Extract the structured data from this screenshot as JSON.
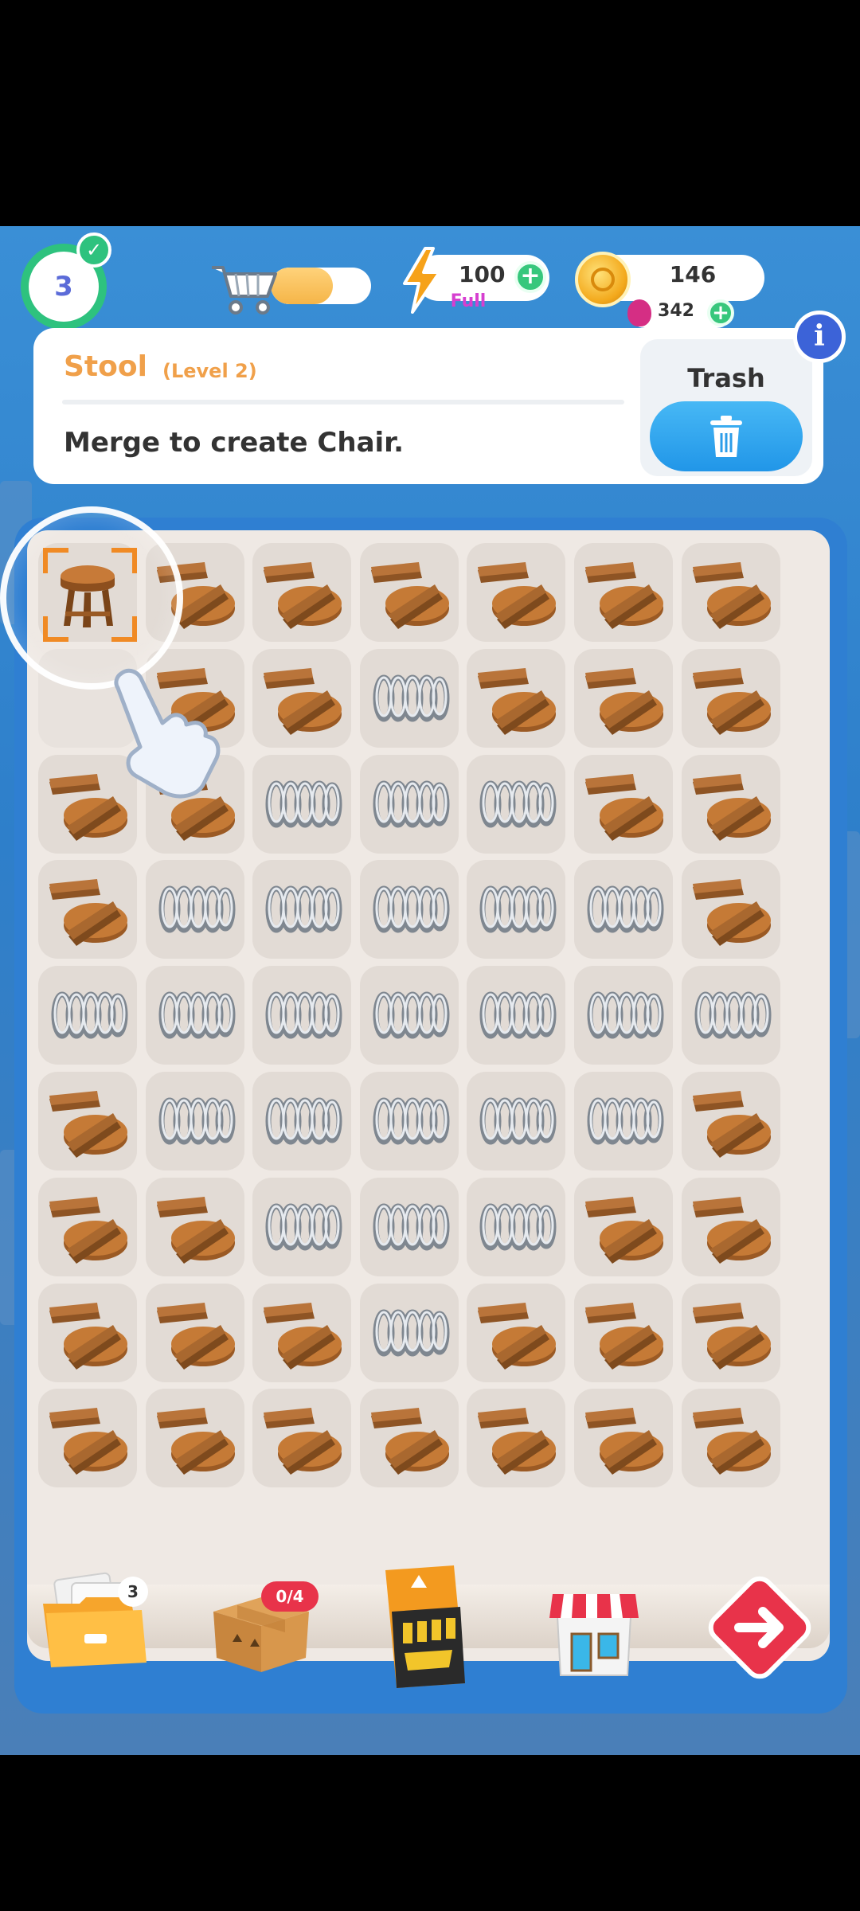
{
  "hud": {
    "level": "3",
    "cart_progress": 0.62,
    "energy": {
      "value": "100",
      "status": "Full"
    },
    "coins": "146",
    "gems": "342"
  },
  "info_panel": {
    "item_name": "Stool",
    "item_level": "(Level 2)",
    "description": "Merge to create Chair.",
    "trash_label": "Trash"
  },
  "board": {
    "columns": 7,
    "rows": 9,
    "selected_cell": "0-0",
    "grid": [
      [
        "stool",
        "plank",
        "plank",
        "plank",
        "plank",
        "plank",
        "plank"
      ],
      [
        "empty",
        "plank",
        "plank",
        "spring",
        "plank",
        "plank",
        "plank"
      ],
      [
        "plank",
        "plank",
        "spring",
        "spring",
        "spring",
        "plank",
        "plank"
      ],
      [
        "plank",
        "spring",
        "spring",
        "spring",
        "spring",
        "spring",
        "plank"
      ],
      [
        "spring",
        "spring",
        "spring",
        "spring",
        "spring",
        "spring",
        "spring"
      ],
      [
        "plank",
        "spring",
        "spring",
        "spring",
        "spring",
        "spring",
        "plank"
      ],
      [
        "plank",
        "plank",
        "spring",
        "spring",
        "spring",
        "plank",
        "plank"
      ],
      [
        "plank",
        "plank",
        "plank",
        "spring",
        "plank",
        "plank",
        "plank"
      ],
      [
        "plank",
        "plank",
        "plank",
        "plank",
        "plank",
        "plank",
        "plank"
      ]
    ]
  },
  "bottom_bar": {
    "folder_count": "3",
    "box_count": "0/4"
  }
}
